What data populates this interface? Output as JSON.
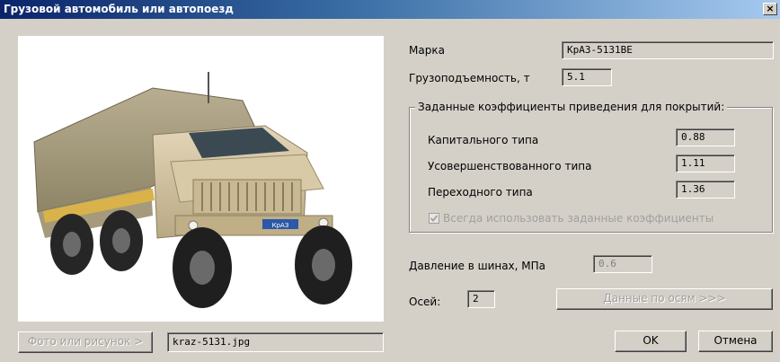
{
  "window": {
    "title": "Грузовой автомобиль или автопоезд",
    "close_label": "×"
  },
  "photo": {
    "plate_text": "КрАЗ"
  },
  "fields": {
    "brand_label": "Марка",
    "brand_value": "КрАЗ-5131ВЕ",
    "capacity_label": "Грузоподъемность, т",
    "capacity_value": "5.1",
    "pressure_label": "Давление в шинах, МПа",
    "pressure_value": "0.6",
    "axles_label": "Осей:",
    "axles_value": "2"
  },
  "coefficients": {
    "group_title": "Заданные коэффициенты приведения для покрытий:",
    "items": [
      {
        "label": "Капитального типа",
        "value": "0.88"
      },
      {
        "label": "Усовершенствованного типа",
        "value": "1.11"
      },
      {
        "label": "Переходного типа",
        "value": "1.36"
      }
    ],
    "always_use_label": "Всегда использовать заданные коэффициенты",
    "always_use_checked": true
  },
  "buttons": {
    "axles_data": "Данные по осям >>>",
    "photo": "Фото или рисунок >",
    "ok": "OK",
    "cancel": "Отмена"
  },
  "photo_file": "kraz-5131.jpg",
  "colors": {
    "title_start": "#0a246a",
    "title_end": "#a6caf0",
    "face": "#d4d0c8"
  }
}
